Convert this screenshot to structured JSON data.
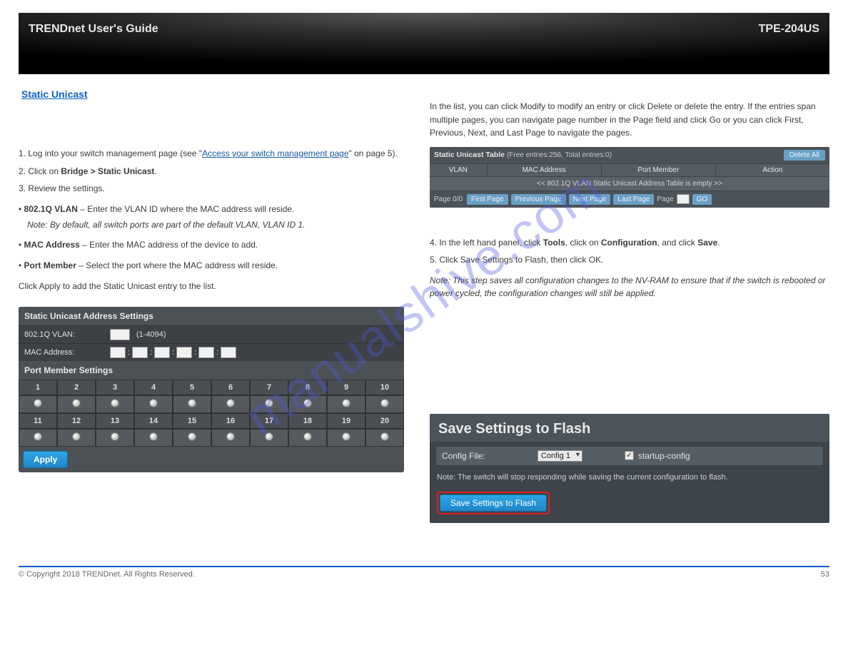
{
  "banner": {
    "left": "TRENDnet User's Guide",
    "right": "TPE-204US"
  },
  "doc_section_title": "Static Unicast",
  "left": {
    "section_label_prefix": "1. Log into your switch management page (see \"",
    "section_label_link": "Access your switch management page",
    "section_label_suffix": "\" on page 5).",
    "nav_click_prefix": "2. Click on ",
    "nav_path": "Bridge > Static Unicast",
    "nav_path_period": ".",
    "setting_prefix": "3. Review the settings.",
    "vlan_desc_label": "802.1Q VLAN",
    "vlan_desc_text": " – Enter the VLAN ID where the MAC address will reside.",
    "vlan_note": "Note: By default, all switch ports are part of the default VLAN, VLAN ID 1.",
    "mac_desc_label": "MAC Address",
    "mac_desc_text": " – Enter the MAC address of the device to add.",
    "port_desc_label": "Port Member",
    "port_desc_text": " – Select the port where the MAC address will reside.",
    "apply_hint": "Click Apply to add the Static Unicast entry to the list.",
    "panel": {
      "settings_head": "Static Unicast Address Settings",
      "vlan_label": "802.1Q VLAN:",
      "vlan_hint": "(1-4094)",
      "mac_label": "MAC Address:",
      "port_head": "Port Member Settings",
      "ports_top": [
        "1",
        "2",
        "3",
        "4",
        "5",
        "6",
        "7",
        "8",
        "9",
        "10"
      ],
      "ports_bottom": [
        "11",
        "12",
        "13",
        "14",
        "15",
        "16",
        "17",
        "18",
        "19",
        "20"
      ],
      "apply": "Apply"
    }
  },
  "right": {
    "list_intro": "In the list, you can click Modify to modify an entry or click Delete or delete the entry. If the entries span multiple pages, you can navigate page number in the Page field and click Go or you can click First, Previous, Next, and Last Page to navigate the pages.",
    "table": {
      "title": "Static Unicast Table",
      "subtitle": "(Free entries:256, Total entries:0)",
      "delete_all": "Delete All",
      "cols": [
        "VLAN",
        "MAC Address",
        "Port Member",
        "Action"
      ],
      "empty": "<< 802.1Q VLAN Static Unicast Address Table is empty >>",
      "page_label": "Page 0/0",
      "first": "First Page",
      "prev": "Previous Page",
      "next": "Next Page",
      "last": "Last Page",
      "page_word": "Page",
      "go": "GO"
    },
    "save4_prefix": "4. In the left hand panel, click ",
    "save4_bold1": "Tools",
    "save4_mid": ", click on ",
    "save4_bold2": "Configuration",
    "save4_mid2": ", and click ",
    "save4_bold3": "Save",
    "save4_period": ".",
    "save5": "5. Click Save Settings to Flash, then click OK.",
    "save_note": "Note: This step saves all configuration changes to the NV-RAM to ensure that if the switch is rebooted or power cycled, the configuration changes will still be applied.",
    "flash": {
      "title": "Save Settings to Flash",
      "config_label": "Config File:",
      "config_value": "Config 1",
      "startup_label": "startup-config",
      "note": "Note: The switch will stop responding while saving the current configuration to flash.",
      "button": "Save Settings to Flash"
    }
  },
  "watermark": "manualshive.com",
  "footer": {
    "left": "© Copyright 2018 TRENDnet. All Rights Reserved.",
    "right": "53"
  }
}
